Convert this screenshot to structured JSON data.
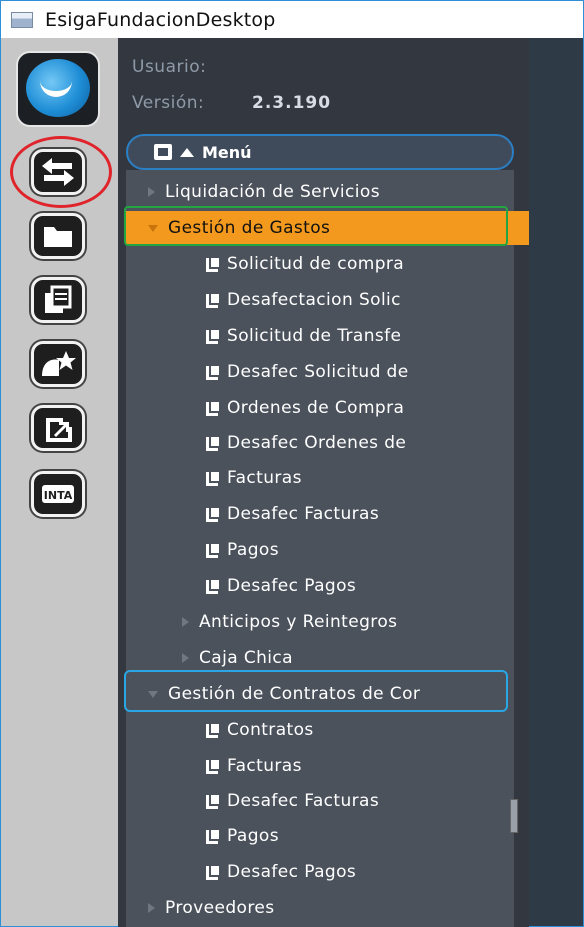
{
  "window": {
    "title": "EsigaFundacionDesktop"
  },
  "header": {
    "user_label": "Usuario:",
    "user_value": "",
    "version_label": "Versión:",
    "version_value": "2.3.190"
  },
  "menu": {
    "label": "Menú"
  },
  "tree": [
    {
      "label": "Liquidación de Servicios",
      "kind": "collapsed",
      "level": 0
    },
    {
      "label": "Gestión de Gastos",
      "kind": "expanded",
      "level": 0,
      "selected": true
    },
    {
      "label": "Solicitud de compra",
      "kind": "leaf",
      "level": 2
    },
    {
      "label": "Desafectacion Solic",
      "kind": "leaf",
      "level": 2
    },
    {
      "label": "Solicitud de Transfe",
      "kind": "leaf",
      "level": 2
    },
    {
      "label": "Desafec Solicitud de",
      "kind": "leaf",
      "level": 2
    },
    {
      "label": "Ordenes de Compra",
      "kind": "leaf",
      "level": 2
    },
    {
      "label": "Desafec Ordenes de",
      "kind": "leaf",
      "level": 2
    },
    {
      "label": "Facturas",
      "kind": "leaf",
      "level": 2
    },
    {
      "label": "Desafec Facturas",
      "kind": "leaf",
      "level": 2
    },
    {
      "label": "Pagos",
      "kind": "leaf",
      "level": 2
    },
    {
      "label": "Desafec Pagos",
      "kind": "leaf",
      "level": 2
    },
    {
      "label": "Anticipos y Reintegros",
      "kind": "collapsed",
      "level": 1
    },
    {
      "label": "Caja Chica",
      "kind": "collapsed",
      "level": 1
    },
    {
      "label": "Gestión de Contratos de Cor",
      "kind": "expanded",
      "level": 0
    },
    {
      "label": "Contratos",
      "kind": "leaf",
      "level": 2
    },
    {
      "label": "Facturas",
      "kind": "leaf",
      "level": 2
    },
    {
      "label": "Desafec Facturas",
      "kind": "leaf",
      "level": 2
    },
    {
      "label": "Pagos",
      "kind": "leaf",
      "level": 2
    },
    {
      "label": "Desafec Pagos",
      "kind": "leaf",
      "level": 2
    },
    {
      "label": "Proveedores",
      "kind": "collapsed",
      "level": 0
    }
  ],
  "sidebar_icons": [
    "swap-arrows-icon",
    "folder-icon",
    "documents-icon",
    "favorites-star-icon",
    "external-link-icon",
    "inta-badge-icon"
  ],
  "sidebar_badge_text": "INTA",
  "colors": {
    "accent": "#f39a1e",
    "panel": "#4b525c",
    "header": "#333840",
    "highlight_red": "#e0242b",
    "highlight_green": "#23a642",
    "highlight_cyan": "#2aa6e4"
  }
}
